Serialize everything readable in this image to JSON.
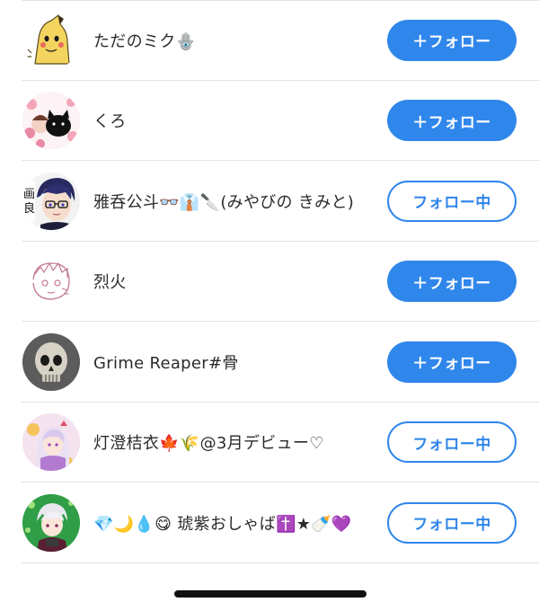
{
  "colors": {
    "accent": "#2f86eb",
    "divider": "#e3e3e3",
    "text": "#2b2b2b",
    "background": "#ffffff"
  },
  "users": [
    {
      "name": "ただのミク🪬",
      "avatar": "mimikyu-avatar",
      "button": "＋フォロー",
      "following": false
    },
    {
      "name": "くろ",
      "avatar": "black-cat-avatar",
      "button": "＋フォロー",
      "following": false
    },
    {
      "name": "雅呑公斗👓👔🔪(みやびの きみと)",
      "avatar": "anime-boy-glasses-avatar",
      "button": "フォロー中",
      "following": true
    },
    {
      "name": "烈火",
      "avatar": "sketch-face-avatar",
      "button": "＋フォロー",
      "following": false
    },
    {
      "name": "Grime Reaper#骨",
      "avatar": "skull-avatar",
      "button": "＋フォロー",
      "following": false
    },
    {
      "name": "灯澄桔衣🍁🌾@3月デビュー♡",
      "avatar": "anime-girl-avatar",
      "button": "フォロー中",
      "following": true
    },
    {
      "name": "💎🌙💧😋 琥紫おしゃば✝️★🍼💜",
      "avatar": "anime-character-green-avatar",
      "button": "フォロー中",
      "following": true
    }
  ]
}
